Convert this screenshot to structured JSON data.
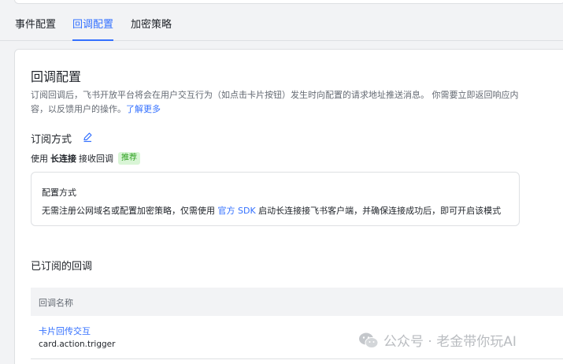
{
  "tabs": [
    {
      "label": "事件配置",
      "active": false
    },
    {
      "label": "回调配置",
      "active": true
    },
    {
      "label": "加密策略",
      "active": false
    }
  ],
  "callback": {
    "title": "回调配置",
    "description": "订阅回调后，飞书开放平台将会在用户交互行为（如点击卡片按钮）发生时向配置的请求地址推送消息。 你需要立即返回响应内容，以反馈用户的操作。",
    "learn_more": "了解更多"
  },
  "subscription": {
    "label": "订阅方式",
    "use_prefix": "使用",
    "mode": "长连接",
    "use_suffix": "接收回调",
    "badge": "推荐"
  },
  "config_box": {
    "title": "配置方式",
    "desc_before": "无需注册公网域名或配置加密策略，仅需使用",
    "sdk_link": "官方 SDK",
    "desc_after": "启动长连接接飞书客户端，并确保连接成功后，即可开启该模式"
  },
  "subscribed": {
    "title": "已订阅的回调",
    "column_header": "回调名称",
    "rows": [
      {
        "name": "卡片回传交互",
        "code": "card.action.trigger"
      }
    ]
  },
  "watermark": "公众号 · 老金带你玩AI",
  "colors": {
    "accent": "#3370ff",
    "badge_bg": "#d9f5d6",
    "badge_text": "#2ea121"
  }
}
